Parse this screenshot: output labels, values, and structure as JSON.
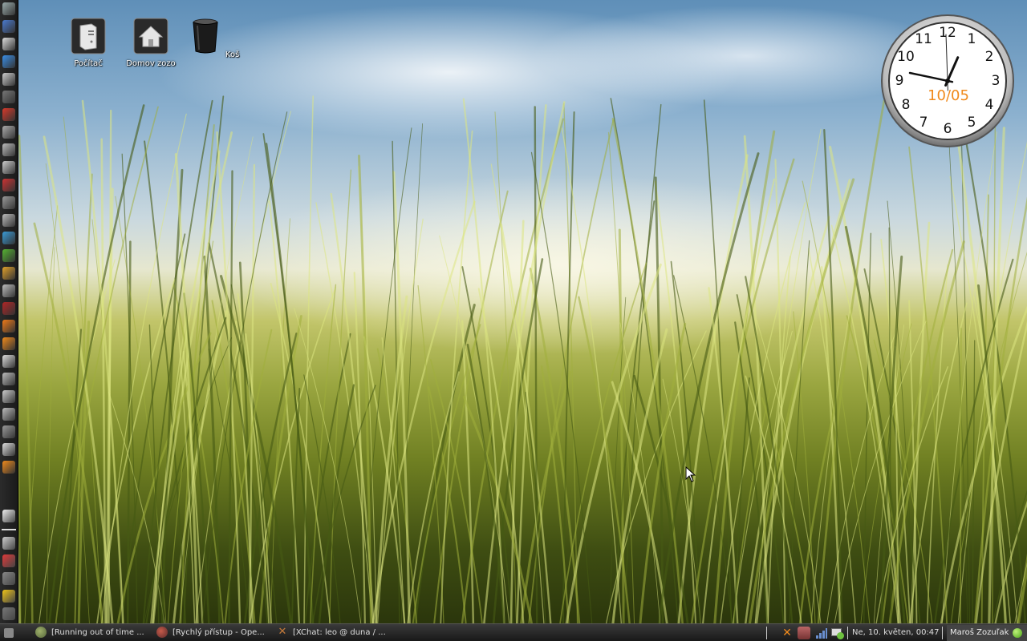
{
  "desktop_icons": [
    {
      "name": "computer",
      "label": "Počítač"
    },
    {
      "name": "home",
      "label": "Domov zozo"
    },
    {
      "name": "trash",
      "label": "Koš"
    }
  ],
  "clock": {
    "numerals": [
      "12",
      "1",
      "2",
      "3",
      "4",
      "5",
      "6",
      "7",
      "8",
      "9",
      "10",
      "11"
    ],
    "date": "10/05",
    "date_color": "#f08a1c",
    "time": {
      "hour": 0,
      "minute": 47
    }
  },
  "left_panel": {
    "launchers": [
      "terminal-icon",
      "network-icon",
      "inkscape-icon",
      "drop-icon",
      "globe-icon",
      "im-icon",
      "opera-icon",
      "calculator-icon",
      "character-map-icon",
      "scanner-icon",
      "red-app-icon",
      "shell-icon",
      "eraser-icon",
      "monitor-icon",
      "green-app-icon",
      "audacious-icon",
      "disk-icon",
      "record-icon",
      "firefox-icon",
      "vlc-icon",
      "printer-icon",
      "screenshot-icon",
      "wrench-icon",
      "keyboard-icon",
      "waveform-icon",
      "tools-icon",
      "xchat-icon"
    ],
    "bottom_icons": [
      "mail-icon",
      "tool-icon",
      "no-entry-icon",
      "gear-panel-icon",
      "folder-icon",
      "settings-icon",
      "exit-icon"
    ]
  },
  "taskbar": {
    "tasks": [
      {
        "icon": "audio-player-icon",
        "label": "[Running out of time ..."
      },
      {
        "icon": "opera-task-icon",
        "label": "[Rychlý přístup - Ope..."
      },
      {
        "icon": "xchat-task-icon",
        "label": "[XChat: leo @ duna / ..."
      }
    ],
    "tray_icons": [
      "xchat-tray-icon",
      "pidgin-tray-icon",
      "signal-tray-icon",
      "network-tray-icon"
    ],
    "datetime": "Ne, 10. květen, 00:47",
    "user": "Maroš Zozuľak"
  }
}
